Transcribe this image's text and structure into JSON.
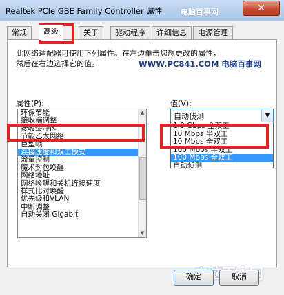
{
  "window": {
    "title": "Realtek PCIe GBE Family Controller 属性",
    "watermark": "电脑百事网",
    "close_glyph": "✕"
  },
  "tabs": [
    {
      "label": "常规"
    },
    {
      "label": "高级"
    },
    {
      "label": "关于"
    },
    {
      "label": "驱动程序"
    },
    {
      "label": "详细信息"
    },
    {
      "label": "电源管理"
    }
  ],
  "panel": {
    "description_line1": "此网络适配器可使用下列属性。在左边单击您想更改的属性，",
    "description_line2": "然后在右边选择它的值。",
    "watermark": "WWW.PC841.COM 电脑百事网",
    "property_label": "属性(P):",
    "value_label": "值(V):"
  },
  "properties": [
    "环保节能",
    "接收端调整",
    "接收缓冲区",
    "节能乙太网络",
    "巨型帧",
    "连接速度和双工模式",
    "流量控制",
    "魔术封包唤醒",
    "网络地址",
    "网络唤醒和关机连接速度",
    "样式比对唤醒",
    "优先级和VLAN",
    "中断调整",
    "自动关闭 Gigabit"
  ],
  "selected_property_index": 5,
  "combo": {
    "value": "自动侦测"
  },
  "dropdown_options": [
    "1.0 Gbps 全双工",
    "10 Mbps 半双工",
    "10 Mbps 全双工",
    "100 Mbps 半双工",
    "100 Mbps 全双工",
    "自动侦测"
  ],
  "selected_option_index": 4,
  "buttons": {
    "ok": "确定",
    "cancel": "取消"
  },
  "logo_text": "电脑百事网",
  "colors": {
    "highlight_box": "#e02424",
    "selection": "#3399ff"
  }
}
